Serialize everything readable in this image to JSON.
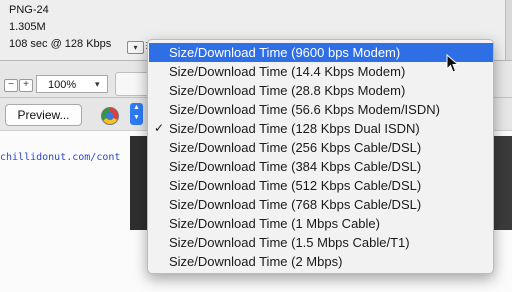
{
  "info": {
    "format": "PNG-24",
    "size": "1.305M",
    "time": "108 sec @ 128 Kbps"
  },
  "zoom": {
    "minus_label": "−",
    "plus_label": "+",
    "value": "100%"
  },
  "preview": {
    "label": "Preview..."
  },
  "url": {
    "text": "chillidonut.com/cont"
  },
  "menu": {
    "items": [
      {
        "label": "Size/Download Time (9600 bps Modem)",
        "selected": true,
        "checked": false
      },
      {
        "label": "Size/Download Time (14.4 Kbps Modem)",
        "selected": false,
        "checked": false
      },
      {
        "label": "Size/Download Time (28.8 Kbps Modem)",
        "selected": false,
        "checked": false
      },
      {
        "label": "Size/Download Time (56.6 Kbps Modem/ISDN)",
        "selected": false,
        "checked": false
      },
      {
        "label": "Size/Download Time (128 Kbps Dual ISDN)",
        "selected": false,
        "checked": true
      },
      {
        "label": "Size/Download Time (256 Kbps Cable/DSL)",
        "selected": false,
        "checked": false
      },
      {
        "label": "Size/Download Time (384 Kbps Cable/DSL)",
        "selected": false,
        "checked": false
      },
      {
        "label": "Size/Download Time (512 Kbps Cable/DSL)",
        "selected": false,
        "checked": false
      },
      {
        "label": "Size/Download Time (768 Kbps Cable/DSL)",
        "selected": false,
        "checked": false
      },
      {
        "label": "Size/Download Time (1 Mbps Cable)",
        "selected": false,
        "checked": false
      },
      {
        "label": "Size/Download Time (1.5 Mbps Cable/T1)",
        "selected": false,
        "checked": false
      },
      {
        "label": "Size/Download Time (2 Mbps)",
        "selected": false,
        "checked": false
      }
    ]
  },
  "colors": {
    "accent": "#2f6fe6",
    "link": "#2a49c9"
  },
  "icons": {
    "check": "✓",
    "menu_button": "▾",
    "stepper": "⇕"
  }
}
